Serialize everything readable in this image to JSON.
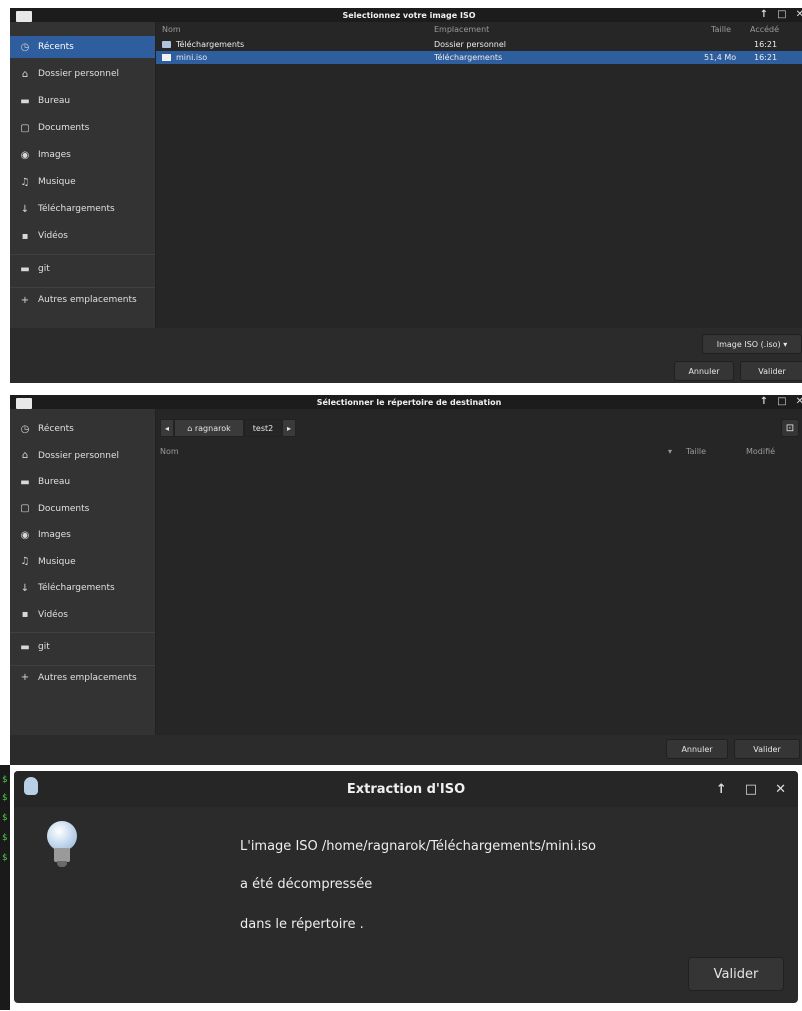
{
  "colors": {
    "accent": "#2e5e9e",
    "window_bg": "#2b2b2b",
    "titlebar_bg": "#1c1c1c",
    "sidebar_bg": "#333333",
    "terminal_green": "#4ec94e"
  },
  "win1": {
    "title": "Selectionnez votre image ISO",
    "sidebar": [
      {
        "label": "Récents",
        "icon": "clock-icon",
        "glyph": "◷",
        "active": true
      },
      {
        "label": "Dossier personnel",
        "icon": "home-icon",
        "glyph": "⌂"
      },
      {
        "label": "Bureau",
        "icon": "folder-icon",
        "glyph": "▬"
      },
      {
        "label": "Documents",
        "icon": "document-icon",
        "glyph": "▢"
      },
      {
        "label": "Images",
        "icon": "camera-icon",
        "glyph": "◉"
      },
      {
        "label": "Musique",
        "icon": "music-icon",
        "glyph": "♫"
      },
      {
        "label": "Téléchargements",
        "icon": "download-icon",
        "glyph": "↓"
      },
      {
        "label": "Vidéos",
        "icon": "video-icon",
        "glyph": "▪"
      },
      {
        "label": "git",
        "icon": "folder-icon",
        "glyph": "▬"
      },
      {
        "label": "Autres emplacements",
        "icon": "plus-icon",
        "glyph": "+"
      }
    ],
    "columns": {
      "name": "Nom",
      "location": "Emplacement",
      "size": "Taille",
      "accessed": "Accédé"
    },
    "rows": [
      {
        "name": "Téléchargements",
        "type": "folder",
        "location": "Dossier personnel",
        "size": "",
        "accessed": "16:21"
      },
      {
        "name": "mini.iso",
        "type": "file",
        "location": "Téléchargements",
        "size": "51,4 Mo",
        "accessed": "16:21",
        "selected": true
      }
    ],
    "filter": "Image ISO (.iso) ▾",
    "cancel": "Annuler",
    "ok": "Valider"
  },
  "win2": {
    "title": "Sélectionner le répertoire de destination",
    "sidebar": [
      {
        "label": "Récents",
        "icon": "clock-icon",
        "glyph": "◷"
      },
      {
        "label": "Dossier personnel",
        "icon": "home-icon",
        "glyph": "⌂"
      },
      {
        "label": "Bureau",
        "icon": "folder-icon",
        "glyph": "▬"
      },
      {
        "label": "Documents",
        "icon": "document-icon",
        "glyph": "▢"
      },
      {
        "label": "Images",
        "icon": "camera-icon",
        "glyph": "◉"
      },
      {
        "label": "Musique",
        "icon": "music-icon",
        "glyph": "♫"
      },
      {
        "label": "Téléchargements",
        "icon": "download-icon",
        "glyph": "↓"
      },
      {
        "label": "Vidéos",
        "icon": "video-icon",
        "glyph": "▪"
      },
      {
        "label": "git",
        "icon": "folder-icon",
        "glyph": "▬"
      },
      {
        "label": "Autres emplacements",
        "icon": "plus-icon",
        "glyph": "+"
      }
    ],
    "path": {
      "back": "◂",
      "home": "⌂ ragnarok",
      "current": "test2",
      "forward": "▸"
    },
    "new_folder_glyph": "⊡",
    "columns": {
      "name": "Nom",
      "size": "Taille",
      "modified": "Modifié"
    },
    "sort_glyph": "▾",
    "cancel": "Annuler",
    "ok": "Valider"
  },
  "win3": {
    "title": "Extraction d'ISO",
    "controls": {
      "pin": "↑",
      "maximize": "□",
      "close": "✕"
    },
    "message": [
      "L'image ISO /home/ragnarok/Téléchargements/mini.iso",
      "a été décompressée",
      "dans le répertoire ."
    ],
    "ok": "Valider"
  }
}
